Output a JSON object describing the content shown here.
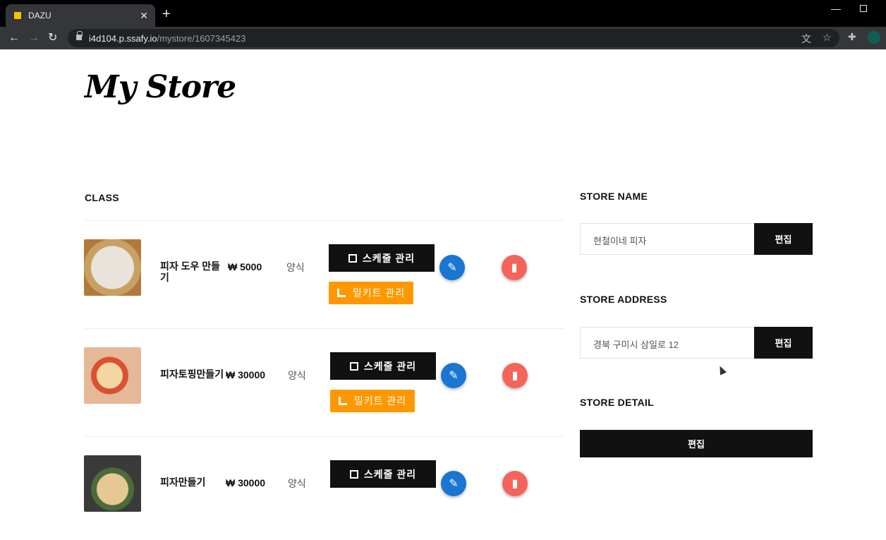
{
  "browser": {
    "tab_title": "DAZU",
    "url_host": "i4d104.p.ssafy.io",
    "url_path": "/mystore/1607345423",
    "new_tab_label": "+",
    "close_label": "✕"
  },
  "page": {
    "title": "My Store"
  },
  "class_section": {
    "label": "CLASS",
    "items": [
      {
        "name": "피자 도우 만들기",
        "price": "₩ 5000",
        "category": "양식",
        "schedule_label": "스케줄 관리",
        "mealkit_label": "밀키트 관리"
      },
      {
        "name": "피자토핑만들기",
        "price": "₩ 30000",
        "category": "양식",
        "schedule_label": "스케줄 관리",
        "mealkit_label": "밀키트 관리"
      },
      {
        "name": "피자만들기",
        "price": "₩ 30000",
        "category": "양식",
        "schedule_label": "스케줄 관리",
        "mealkit_label": ""
      }
    ]
  },
  "store": {
    "name_label": "STORE NAME",
    "name_value": "현철이네 피자",
    "address_label": "STORE ADDRESS",
    "address_value": "경북 구미시 삼일로 12",
    "detail_label": "STORE DETAIL",
    "edit_label": "편집"
  },
  "colors": {
    "schedule_button": "#111111",
    "mealkit_button": "#ff9800",
    "edit_fab": "#1976d2",
    "delete_fab": "#f4645a"
  }
}
